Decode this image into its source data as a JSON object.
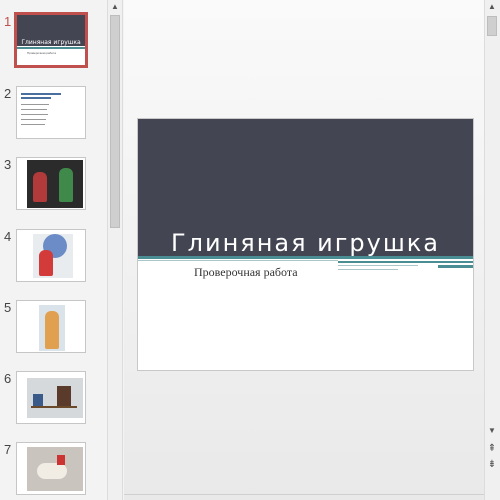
{
  "thumbnails": [
    {
      "num": "1",
      "title": "Глиняная игрушка",
      "subtitle": "Проверочная работа",
      "selected": true
    },
    {
      "num": "2",
      "lines": [
        "Дымковская игрушка",
        "Каргопольская игрушка",
        "Филимоновская игрушка",
        "Абашевская игрушка",
        "Романовская игрушка"
      ]
    },
    {
      "num": "3"
    },
    {
      "num": "4"
    },
    {
      "num": "5"
    },
    {
      "num": "6"
    },
    {
      "num": "7"
    }
  ],
  "slide": {
    "title": "Глиняная игрушка",
    "subtitle": "Проверочная работа"
  },
  "colors": {
    "header": "#434553",
    "accent": "#4a8e93",
    "selection": "#c0504d"
  },
  "icons": {
    "scroll_up": "▲",
    "scroll_down": "▼",
    "prev_slide": "⇞",
    "next_slide": "⇟"
  }
}
